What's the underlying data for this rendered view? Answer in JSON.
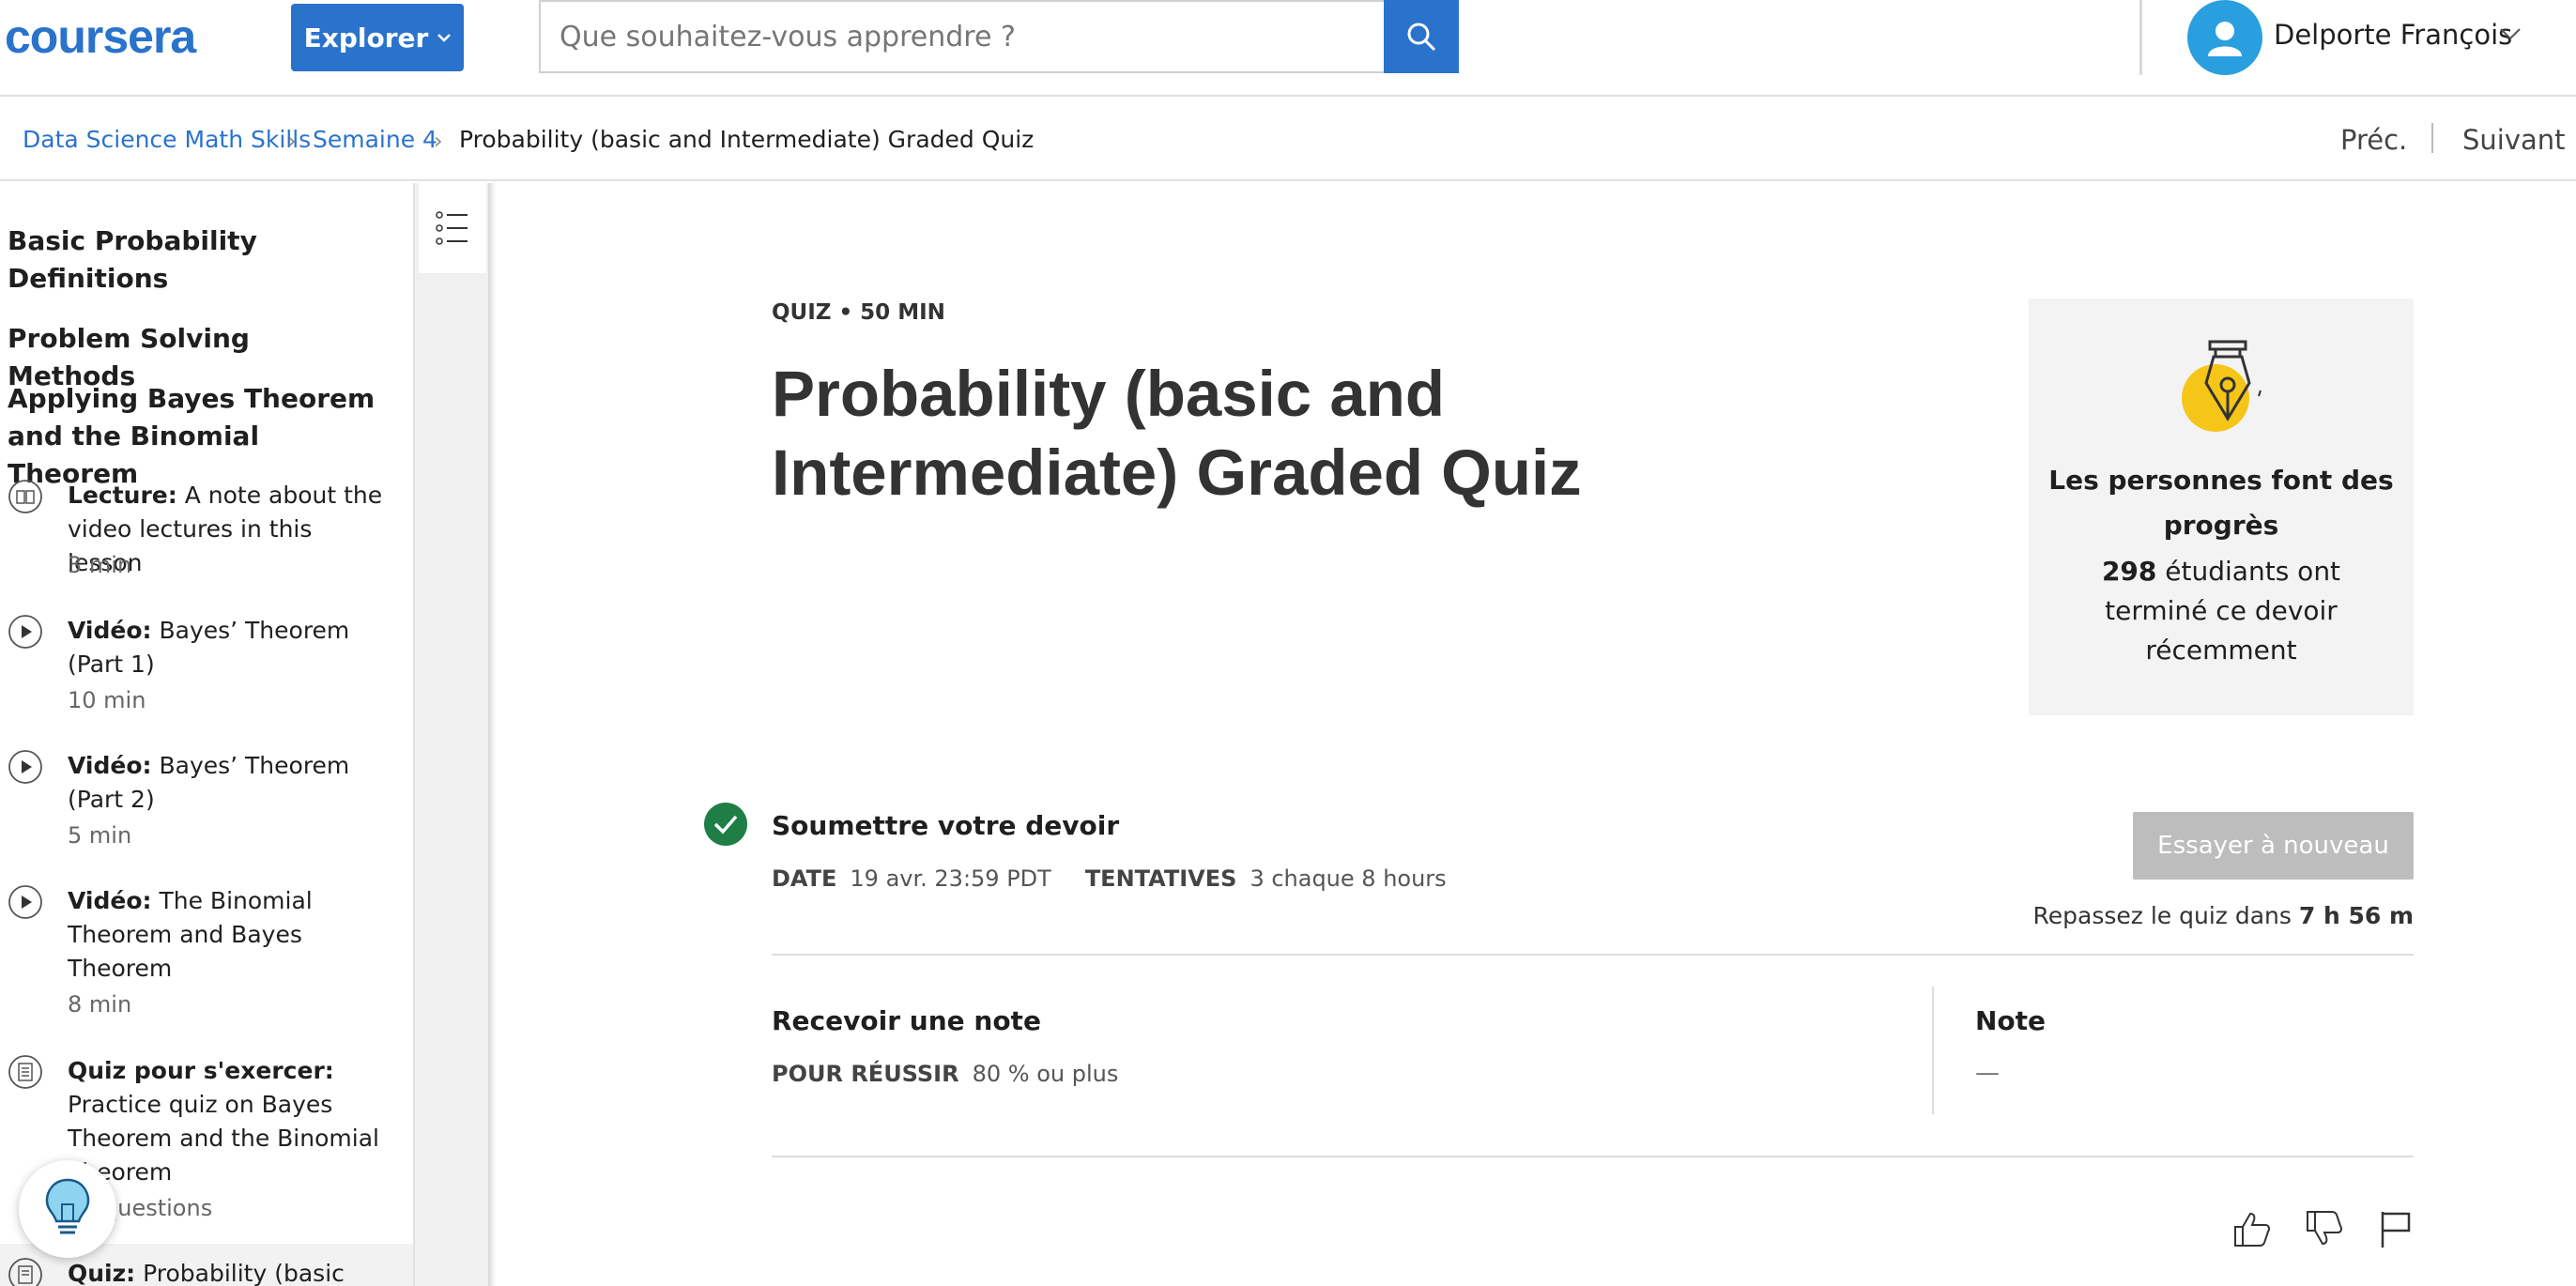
{
  "header": {
    "logo": "coursera",
    "explore_label": "Explorer",
    "search_placeholder": "Que souhaitez-vous apprendre ?",
    "user_name": "Delporte François"
  },
  "breadcrumb": {
    "items": [
      "Data Science Math Skills",
      "Semaine 4",
      "Probability (basic and Intermediate) Graded Quiz"
    ],
    "prev_label": "Préc.",
    "next_label": "Suivant"
  },
  "sidebar": {
    "headings": [
      "Basic Probability Definitions",
      "Problem Solving Methods",
      "Applying Bayes Theorem and the Binomial Theorem"
    ],
    "items": [
      {
        "type": "Lecture:",
        "title": "A note about the video lectures in this lesson",
        "meta": "3  min",
        "icon": "book-icon"
      },
      {
        "type": "Vidéo:",
        "title": "Bayes’ Theorem (Part 1)",
        "meta": "10  min",
        "icon": "play-icon"
      },
      {
        "type": "Vidéo:",
        "title": "Bayes’ Theorem (Part 2)",
        "meta": "5  min",
        "icon": "play-icon"
      },
      {
        "type": "Vidéo:",
        "title": "The Binomial Theorem and Bayes Theorem",
        "meta": "8  min",
        "icon": "play-icon"
      },
      {
        "type": "Quiz pour s'exercer:",
        "title": "Practice quiz on Bayes Theorem and the Binomial Theorem",
        "meta": "questions",
        "icon": "quiz-icon"
      },
      {
        "type": "Quiz:",
        "title": "Probability (basic and",
        "meta": "",
        "icon": "quiz-icon"
      }
    ]
  },
  "quiz": {
    "kicker": "QUIZ • 50  MIN",
    "title": "Probability (basic and Intermediate) Graded Quiz",
    "progress_title": "Les personnes font des progrès",
    "progress_count": "298",
    "progress_text": " étudiants ont terminé ce devoir récemment",
    "submit_title": "Soumettre votre devoir",
    "date_label": "DATE",
    "date_value": "19 avr. 23:59 PDT",
    "attempts_label": "TENTATIVES",
    "attempts_value": "3 chaque 8  hours",
    "retry_label": "Essayer à nouveau",
    "retake_prefix": "Repassez le quiz dans ",
    "retake_time": "7 h 56 m",
    "grade_title": "Recevoir une note",
    "pass_label": "POUR RÉUSSIR",
    "pass_value": "80 % ou plus",
    "note_title": "Note",
    "note_value": "—"
  },
  "colors": {
    "brand": "#2a73cc",
    "success": "#1e7e46",
    "disabled": "#bdbdbd",
    "accent_yellow": "#f5c518"
  }
}
